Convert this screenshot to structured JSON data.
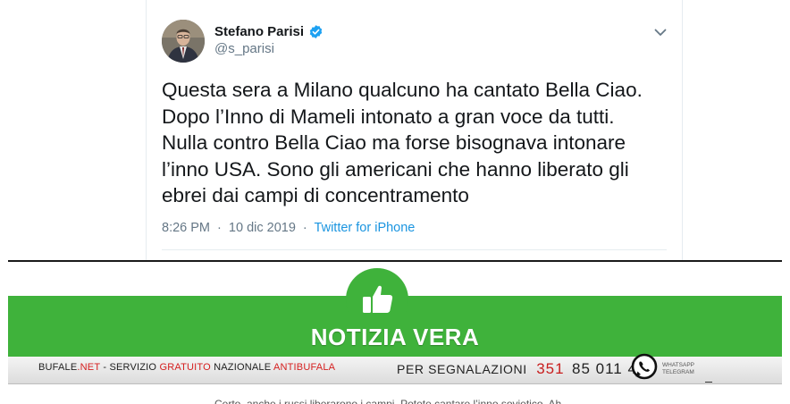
{
  "tweet": {
    "author_name": "Stefano Parisi",
    "handle": "@s_parisi",
    "text_lines": [
      "Questa sera a Milano qualcuno ha cantato Bella Ciao.",
      "Dopo l’Inno di Mameli intonato a gran voce da tutti.",
      "Nulla contro Bella Ciao ma forse bisognava intonare",
      "l’inno USA.  Sono gli americani che hanno liberato gli",
      "ebrei dai campi di concentramento"
    ],
    "time": "8:26 PM",
    "separator": "·",
    "date": "10 dic 2019",
    "source": "Twitter for iPhone",
    "icons": [
      "verified-badge-icon",
      "chevron-down-icon"
    ],
    "colors": {
      "text": "#14171a",
      "secondary": "#657786",
      "link": "#1b95e0",
      "verified": "#1da1f2"
    }
  },
  "banner": {
    "title": "NOTIZIA VERA",
    "brand_1": "BUFALE",
    "brand_2": ".NET",
    "tagline_1": " - SERVIZIO ",
    "tagline_2": "GRATUITO",
    "tagline_3": " NAZIONALE ",
    "tagline_4": "ANTIBUFALA",
    "report_label": "PER SEGNALAZIONI",
    "phone_1": "351",
    "phone_2": "85 011 48",
    "whatsapp_label": "WHATSAPP",
    "telegram_label": "TELEGRAM",
    "cut_text": "Certo, anche i russi liberarono i campi. Potete cantare l’inno sovietico. Ah",
    "icons": [
      "thumbs-up-icon",
      "whatsapp-icon"
    ],
    "colors": {
      "green": "#3fb23b",
      "red": "#d62020"
    }
  }
}
